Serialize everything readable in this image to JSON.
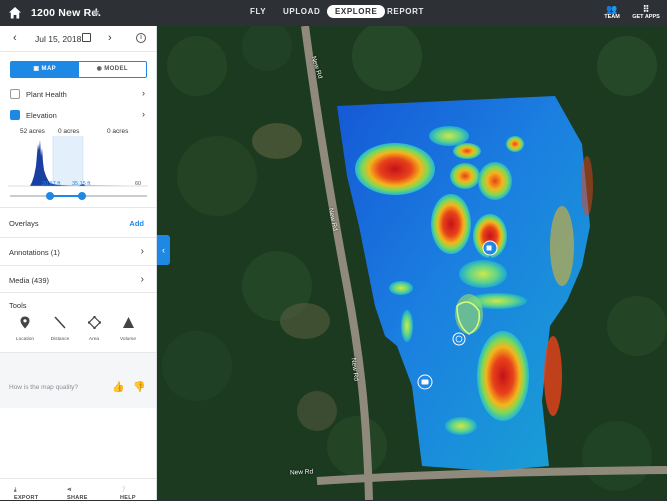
{
  "topbar": {
    "project_name": "1200 New Rd.",
    "nav": [
      "FLY",
      "UPLOAD",
      "EXPLORE",
      "REPORT"
    ],
    "active_nav": "EXPLORE",
    "team_label": "TEAM",
    "apps_label": "GET APPS"
  },
  "sidebar": {
    "date": "Jul 15, 2018",
    "view_toggle": {
      "map_label": "MAP",
      "model_label": "MODEL"
    },
    "layers": [
      {
        "label": "Plant Health"
      },
      {
        "label": "Elevation"
      }
    ],
    "histogram": {
      "acres": [
        "52 acres",
        "0 acres",
        "0 acres"
      ],
      "min_label": "20.67 ft",
      "max_label": "35.15 ft",
      "axis_end": "60"
    },
    "overlays": {
      "title": "Overlays",
      "action": "Add"
    },
    "annotations": {
      "title": "Annotations (1)"
    },
    "media": {
      "title": "Media (439)"
    },
    "tools": {
      "title": "Tools",
      "items": [
        "Location",
        "Distance",
        "Area",
        "Volume"
      ]
    },
    "quality_prompt": "How is the map quality?",
    "footer": {
      "export": "EXPORT",
      "share": "SHARE",
      "help": "HELP"
    }
  },
  "map": {
    "road_labels": [
      "New Rd",
      "New Rd",
      "New Rd",
      "New Rd"
    ]
  },
  "colors": {
    "accent": "#1e88e5",
    "topbar": "#2d3035"
  }
}
